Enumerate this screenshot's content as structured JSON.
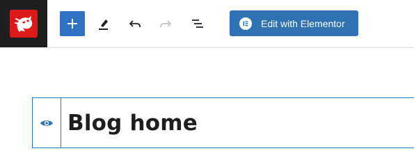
{
  "toolbar": {
    "site_icon": "dragon-logo-icon",
    "add_block_icon": "plus-icon",
    "tools_icon": "pen-icon",
    "undo_icon": "undo-icon",
    "redo_icon": "redo-icon",
    "outline_icon": "list-view-icon",
    "elementor_button_label": "Edit with Elementor",
    "elementor_icon": "elementor-icon"
  },
  "editor": {
    "visibility_icon": "eye-icon",
    "title": "Blog home"
  },
  "colors": {
    "accent": "#3073c4",
    "elementor": "#2f72b3",
    "logo_bg": "#dc1a1a",
    "dark": "#1e1e1e",
    "border": "#2973b8"
  }
}
